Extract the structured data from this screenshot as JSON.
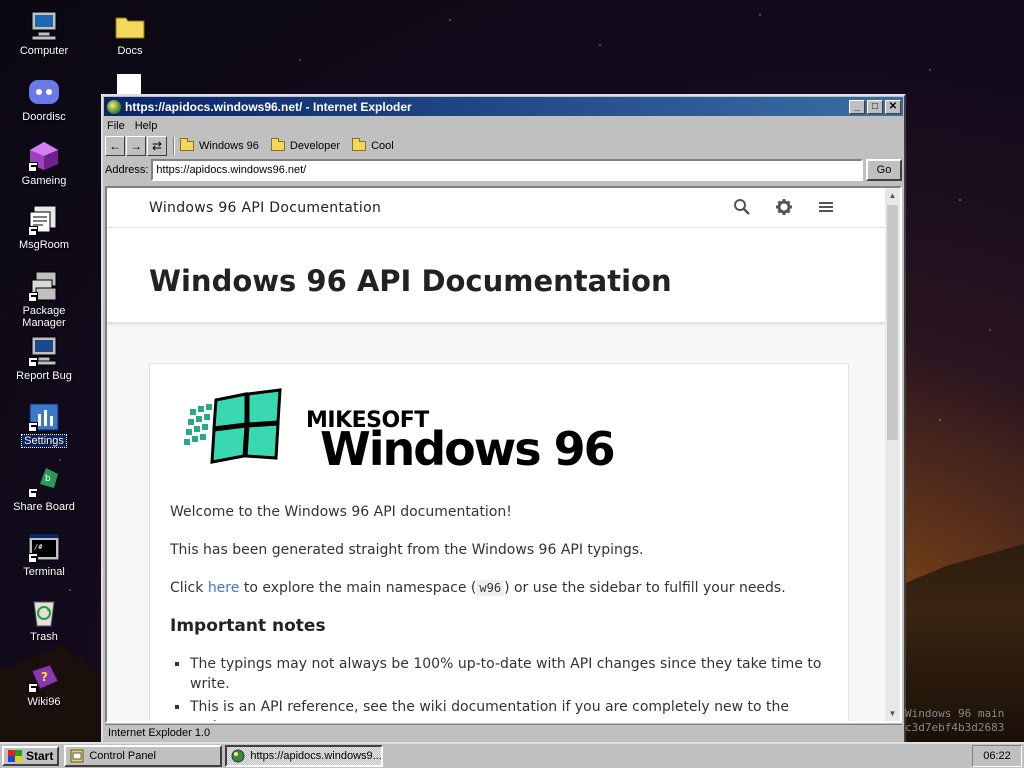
{
  "desktop": {
    "icons": [
      {
        "label": "Computer",
        "icon": "computer-icon"
      },
      {
        "label": "Doordisc",
        "icon": "doordisc-icon"
      },
      {
        "label": "Gameing",
        "icon": "gameing-icon"
      },
      {
        "label": "MsgRoom",
        "icon": "msgroom-icon"
      },
      {
        "label": "Package Manager",
        "icon": "package-manager-icon"
      },
      {
        "label": "Report Bug",
        "icon": "report-bug-icon"
      },
      {
        "label": "Settings",
        "icon": "settings-icon"
      },
      {
        "label": "Share Board",
        "icon": "share-board-icon"
      },
      {
        "label": "Terminal",
        "icon": "terminal-icon"
      },
      {
        "label": "Trash",
        "icon": "trash-icon"
      },
      {
        "label": "Wiki96",
        "icon": "wiki96-icon"
      },
      {
        "label": "Docs",
        "icon": "folder-icon"
      }
    ],
    "selected": "Settings"
  },
  "window": {
    "title": "https://apidocs.windows96.net/ - Internet Exploder",
    "menu": [
      "File",
      "Help"
    ],
    "nav": {
      "back": "←",
      "forward": "→",
      "refresh": "⇄"
    },
    "favorites": [
      "Windows 96",
      "Developer",
      "Cool"
    ],
    "address_label": "Address:",
    "address_value": "https://apidocs.windows96.net/",
    "go_label": "Go",
    "status_text": "Internet Exploder 1.0"
  },
  "page": {
    "brand": "Windows 96 API Documentation",
    "heading": "Windows 96 API Documentation",
    "logo_top": "MIKESOFT",
    "logo_bottom": "Windows 96",
    "welcome": "Welcome to the Windows 96 API documentation!",
    "generated": "This has been generated straight from the Windows 96 API typings.",
    "click_pre": "Click ",
    "click_link": "here",
    "click_mid": " to explore the main namespace (",
    "click_code": "w96",
    "click_post": ") or use the sidebar to fulfill your needs.",
    "notes_heading": "Important notes",
    "notes": [
      "The typings may not always be 100% up-to-date with API changes since they take time to write.",
      "This is an API reference, see the wiki documentation if you are completely new to the project."
    ]
  },
  "watermark": [
    "Windows 96 main",
    "c3d7ebf4b3d2683"
  ],
  "taskbar": {
    "start_label": "Start",
    "tasks": [
      {
        "label": "Control Panel",
        "active": false
      },
      {
        "label": "https://apidocs.windows9...",
        "active": true
      }
    ],
    "clock": "06:22"
  },
  "colors": {
    "titlebar": "#0a246a",
    "chrome": "#c0c0c0",
    "link": "#4078c0",
    "selection": "#0a246a"
  }
}
